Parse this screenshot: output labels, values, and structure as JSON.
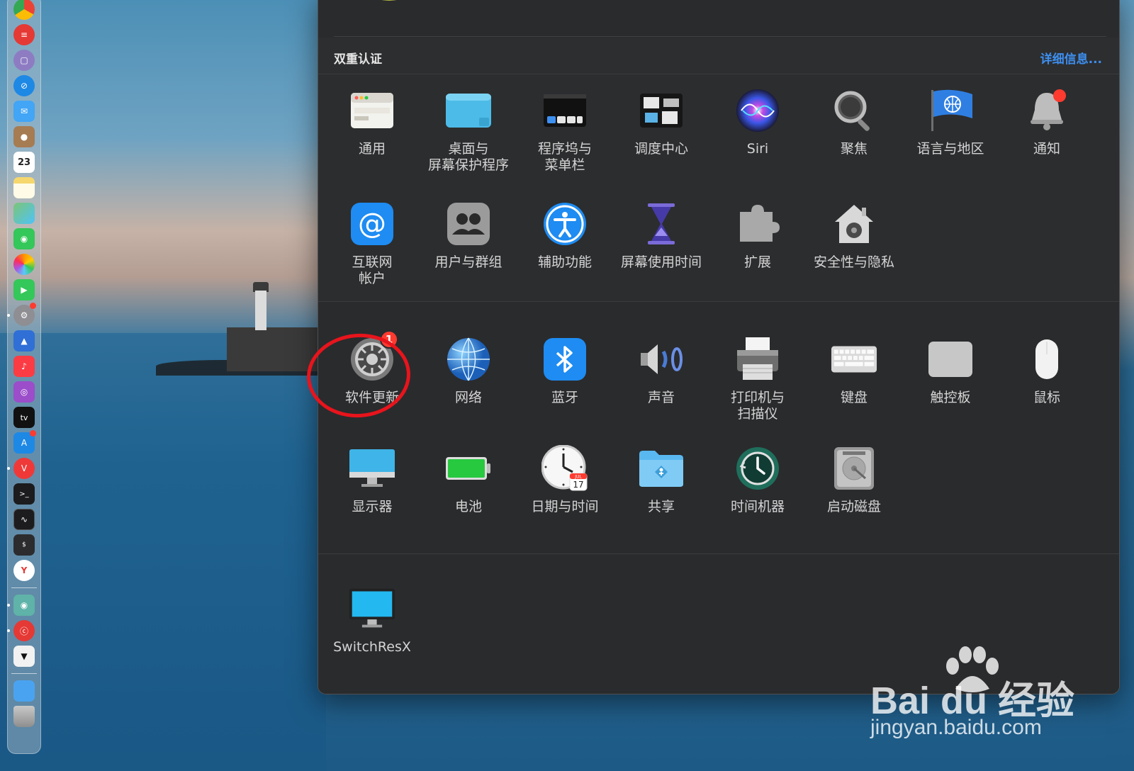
{
  "window": {
    "twofa_title": "双重认证",
    "twofa_link": "详细信息..."
  },
  "panes_row1": [
    {
      "name": "pane-general",
      "icon": "general-icon",
      "label1": "通用",
      "label2": ""
    },
    {
      "name": "pane-desktop-screensaver",
      "icon": "desktop-icon",
      "label1": "桌面与",
      "label2": "屏幕保护程序"
    },
    {
      "name": "pane-dock-menubar",
      "icon": "dock-icon",
      "label1": "程序坞与",
      "label2": "菜单栏"
    },
    {
      "name": "pane-mission-control",
      "icon": "mission-control-icon",
      "label1": "调度中心",
      "label2": ""
    },
    {
      "name": "pane-siri",
      "icon": "siri-icon",
      "label1": "Siri",
      "label2": ""
    },
    {
      "name": "pane-spotlight",
      "icon": "magnifier-icon",
      "label1": "聚焦",
      "label2": ""
    },
    {
      "name": "pane-language-region",
      "icon": "flag-globe-icon",
      "label1": "语言与地区",
      "label2": ""
    },
    {
      "name": "pane-notifications",
      "icon": "bell-icon",
      "label1": "通知",
      "label2": ""
    }
  ],
  "panes_row2": [
    {
      "name": "pane-internet-accounts",
      "icon": "at-icon",
      "label1": "互联网",
      "label2": "帐户"
    },
    {
      "name": "pane-users-groups",
      "icon": "users-icon",
      "label1": "用户与群组",
      "label2": ""
    },
    {
      "name": "pane-accessibility",
      "icon": "accessibility-icon",
      "label1": "辅助功能",
      "label2": ""
    },
    {
      "name": "pane-screen-time",
      "icon": "hourglass-icon",
      "label1": "屏幕使用时间",
      "label2": ""
    },
    {
      "name": "pane-extensions",
      "icon": "puzzle-icon",
      "label1": "扩展",
      "label2": ""
    },
    {
      "name": "pane-security-privacy",
      "icon": "house-lock-icon",
      "label1": "安全性与隐私",
      "label2": ""
    }
  ],
  "panes_row3": [
    {
      "name": "pane-software-update",
      "icon": "gear-icon",
      "label1": "软件更新",
      "label2": "",
      "badge": "1"
    },
    {
      "name": "pane-network",
      "icon": "globe-icon",
      "label1": "网络",
      "label2": ""
    },
    {
      "name": "pane-bluetooth",
      "icon": "bluetooth-icon",
      "label1": "蓝牙",
      "label2": ""
    },
    {
      "name": "pane-sound",
      "icon": "speaker-icon",
      "label1": "声音",
      "label2": ""
    },
    {
      "name": "pane-printers-scanners",
      "icon": "printer-icon",
      "label1": "打印机与",
      "label2": "扫描仪"
    },
    {
      "name": "pane-keyboard",
      "icon": "keyboard-icon",
      "label1": "键盘",
      "label2": ""
    },
    {
      "name": "pane-trackpad",
      "icon": "trackpad-icon",
      "label1": "触控板",
      "label2": ""
    },
    {
      "name": "pane-mouse",
      "icon": "mouse-icon",
      "label1": "鼠标",
      "label2": ""
    }
  ],
  "panes_row4": [
    {
      "name": "pane-displays",
      "icon": "display-icon",
      "label1": "显示器",
      "label2": ""
    },
    {
      "name": "pane-battery",
      "icon": "battery-icon",
      "label1": "电池",
      "label2": ""
    },
    {
      "name": "pane-date-time",
      "icon": "clock-icon",
      "label1": "日期与时间",
      "label2": ""
    },
    {
      "name": "pane-sharing",
      "icon": "folder-share-icon",
      "label1": "共享",
      "label2": ""
    },
    {
      "name": "pane-time-machine",
      "icon": "time-machine-icon",
      "label1": "时间机器",
      "label2": ""
    },
    {
      "name": "pane-startup-disk",
      "icon": "disk-icon",
      "label1": "启动磁盘",
      "label2": ""
    }
  ],
  "panes_row5": [
    {
      "name": "pane-switchresx",
      "icon": "monitor-icon",
      "label1": "SwitchResX",
      "label2": ""
    }
  ],
  "calendar_icon": {
    "month": "JUL",
    "day": "17"
  },
  "dock_calendar_day": "23",
  "dock_tv_label": "tv",
  "watermark": {
    "brand": "Bai du 经验",
    "domain": "jingyan.baidu.com"
  }
}
